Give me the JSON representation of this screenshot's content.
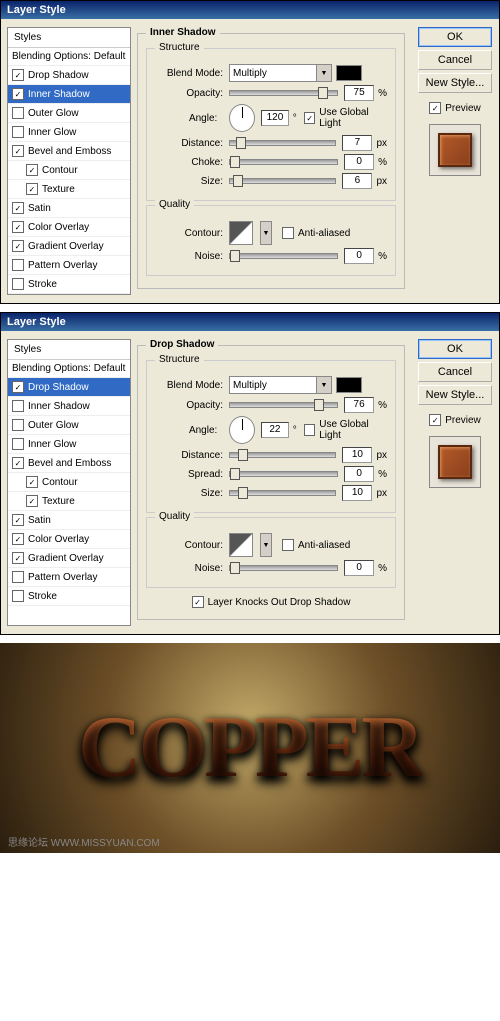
{
  "dialogs": [
    {
      "title": "Layer Style",
      "stylesHeader": "Styles",
      "blendingHeader": "Blending Options: Default",
      "items": [
        {
          "label": "Drop Shadow",
          "checked": true,
          "selected": false
        },
        {
          "label": "Inner Shadow",
          "checked": true,
          "selected": true
        },
        {
          "label": "Outer Glow",
          "checked": false
        },
        {
          "label": "Inner Glow",
          "checked": false
        },
        {
          "label": "Bevel and Emboss",
          "checked": true
        },
        {
          "label": "Contour",
          "checked": true,
          "sub": true
        },
        {
          "label": "Texture",
          "checked": true,
          "sub": true
        },
        {
          "label": "Satin",
          "checked": true
        },
        {
          "label": "Color Overlay",
          "checked": true
        },
        {
          "label": "Gradient Overlay",
          "checked": true
        },
        {
          "label": "Pattern Overlay",
          "checked": false
        },
        {
          "label": "Stroke",
          "checked": false
        }
      ],
      "panelTitle": "Inner Shadow",
      "structure": {
        "blendMode": "Multiply",
        "opacity": "75",
        "opacityPct": 82,
        "angle": "120",
        "useGlobal": true,
        "useGlobalLabel": "Use Global Light",
        "distance": "7",
        "distancePct": 6,
        "choke": "0",
        "chokePct": 0,
        "chokeLabel": "Choke:",
        "size": "6",
        "sizePct": 3
      },
      "quality": {
        "antiAliased": false,
        "noise": "0",
        "noisePct": 0
      },
      "layerKnocks": null
    },
    {
      "title": "Layer Style",
      "stylesHeader": "Styles",
      "blendingHeader": "Blending Options: Default",
      "items": [
        {
          "label": "Drop Shadow",
          "checked": true,
          "selected": true
        },
        {
          "label": "Inner Shadow",
          "checked": false
        },
        {
          "label": "Outer Glow",
          "checked": false
        },
        {
          "label": "Inner Glow",
          "checked": false
        },
        {
          "label": "Bevel and Emboss",
          "checked": true
        },
        {
          "label": "Contour",
          "checked": true,
          "sub": true
        },
        {
          "label": "Texture",
          "checked": true,
          "sub": true
        },
        {
          "label": "Satin",
          "checked": true
        },
        {
          "label": "Color Overlay",
          "checked": true
        },
        {
          "label": "Gradient Overlay",
          "checked": true
        },
        {
          "label": "Pattern Overlay",
          "checked": false
        },
        {
          "label": "Stroke",
          "checked": false
        }
      ],
      "panelTitle": "Drop Shadow",
      "structure": {
        "blendMode": "Multiply",
        "opacity": "76",
        "opacityPct": 78,
        "angle": "22",
        "useGlobal": false,
        "useGlobalLabel": "Use Global Light",
        "distance": "10",
        "distancePct": 8,
        "choke": "0",
        "chokePct": 0,
        "chokeLabel": "Spread:",
        "size": "10",
        "sizePct": 8
      },
      "quality": {
        "antiAliased": false,
        "noise": "0",
        "noisePct": 0
      },
      "layerKnocks": {
        "checked": true,
        "label": "Layer Knocks Out Drop Shadow"
      }
    }
  ],
  "labels": {
    "blendMode": "Blend Mode:",
    "opacity": "Opacity:",
    "angle": "Angle:",
    "distance": "Distance:",
    "size": "Size:",
    "px": "px",
    "pct": "%",
    "deg": "°",
    "structure": "Structure",
    "quality": "Quality",
    "contour": "Contour:",
    "antiAliased": "Anti-aliased",
    "noise": "Noise:"
  },
  "buttons": {
    "ok": "OK",
    "cancel": "Cancel",
    "newStyle": "New Style...",
    "preview": "Preview"
  },
  "result": {
    "text": "COPPER",
    "watermark": "思缘论坛   WWW.MISSYUAN.COM"
  }
}
